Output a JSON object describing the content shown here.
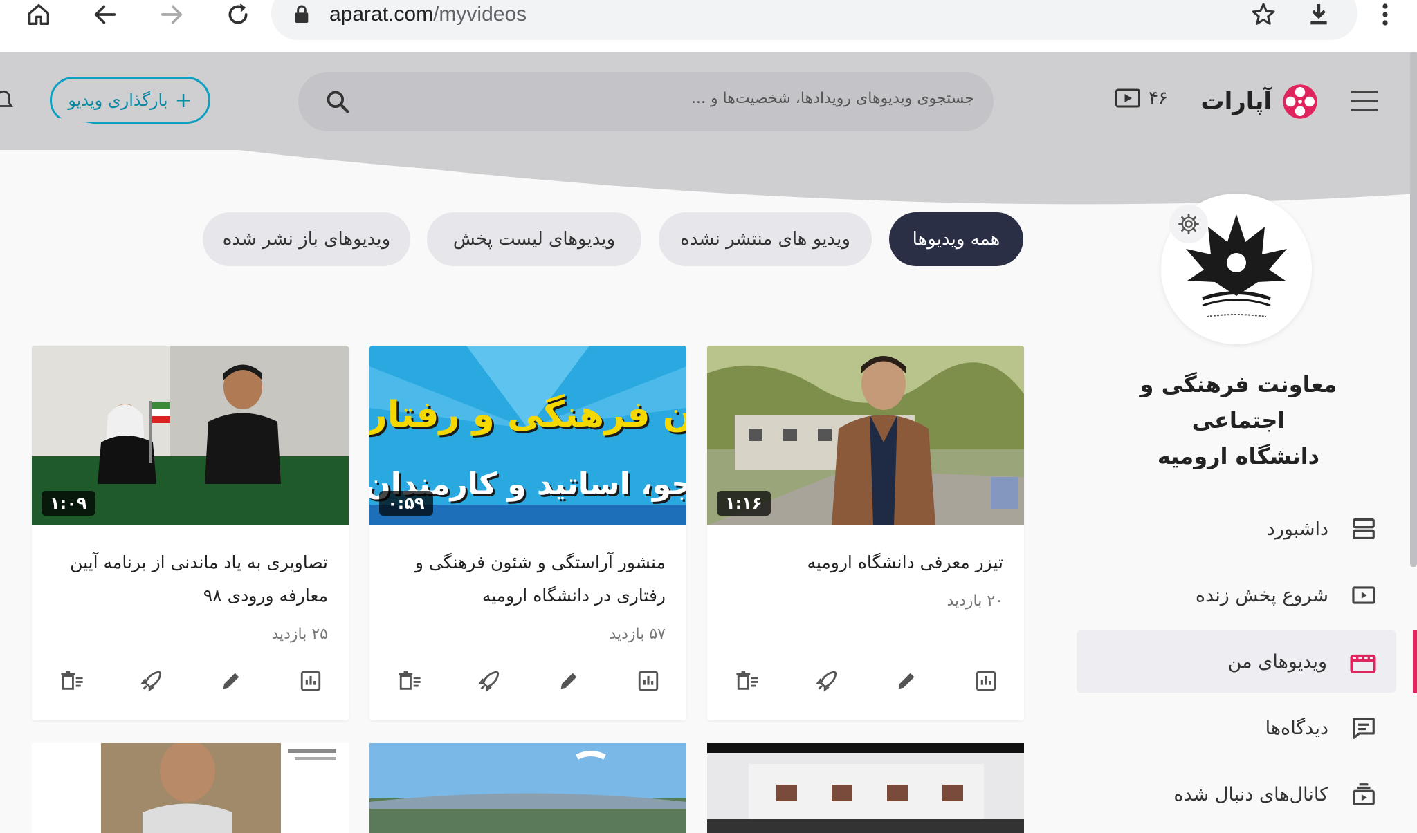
{
  "browser": {
    "url_domain": "aparat.com",
    "url_path": "/myvideos"
  },
  "header": {
    "logo_text": "آپارات",
    "live_count": "۴۶",
    "search_placeholder": "جستجوی ویدیوهای رویدادها، شخصیت‌ها و ...",
    "upload_label": "بارگذاری ویدیو",
    "upload_plus": "+"
  },
  "channel": {
    "name_line1": "معاونت فرهنگی و اجتماعی",
    "name_line2": "دانشگاه ارومیه"
  },
  "sidebar": {
    "items": [
      {
        "label": "داشبورد",
        "icon": "dashboard-icon"
      },
      {
        "label": "شروع پخش زنده",
        "icon": "live-icon"
      },
      {
        "label": "ویدیوهای من",
        "icon": "my-videos-icon",
        "active": true
      },
      {
        "label": "دیدگاه‌ها",
        "icon": "comments-icon"
      },
      {
        "label": "کانال‌های دنبال شده",
        "icon": "followed-channels-icon"
      }
    ]
  },
  "tabs": [
    {
      "label": "همه ویدیوها",
      "active": true
    },
    {
      "label": "ویدیو های منتشر نشده"
    },
    {
      "label": "ویدیوهای لیست پخش"
    },
    {
      "label": "ویدیوهای باز نشر شده"
    }
  ],
  "videos": [
    {
      "title": "تیزر معرفی دانشگاه ارومیه",
      "views": "۲۰ بازدید",
      "duration": "۱:۱۶"
    },
    {
      "title": "منشور آراستگی و شئون فرهنگی و رفتاری در دانشگاه ارومیه",
      "views": "۵۷ بازدید",
      "duration": "۰:۵۹",
      "thumb_text_1": "ن فرهنگی و رفتاری",
      "thumb_text_2": "جو، اساتید و کارمندان با"
    },
    {
      "title": "تصاویری به یاد ماندنی از برنامه آیین معارفه ورودی ۹۸",
      "views": "۲۵ بازدید",
      "duration": "۱:۰۹"
    }
  ],
  "colors": {
    "accent": "#0da0c0",
    "active_tab": "#2b2f45",
    "active_marker": "#e0245e",
    "logo_red": "#e0245e"
  }
}
